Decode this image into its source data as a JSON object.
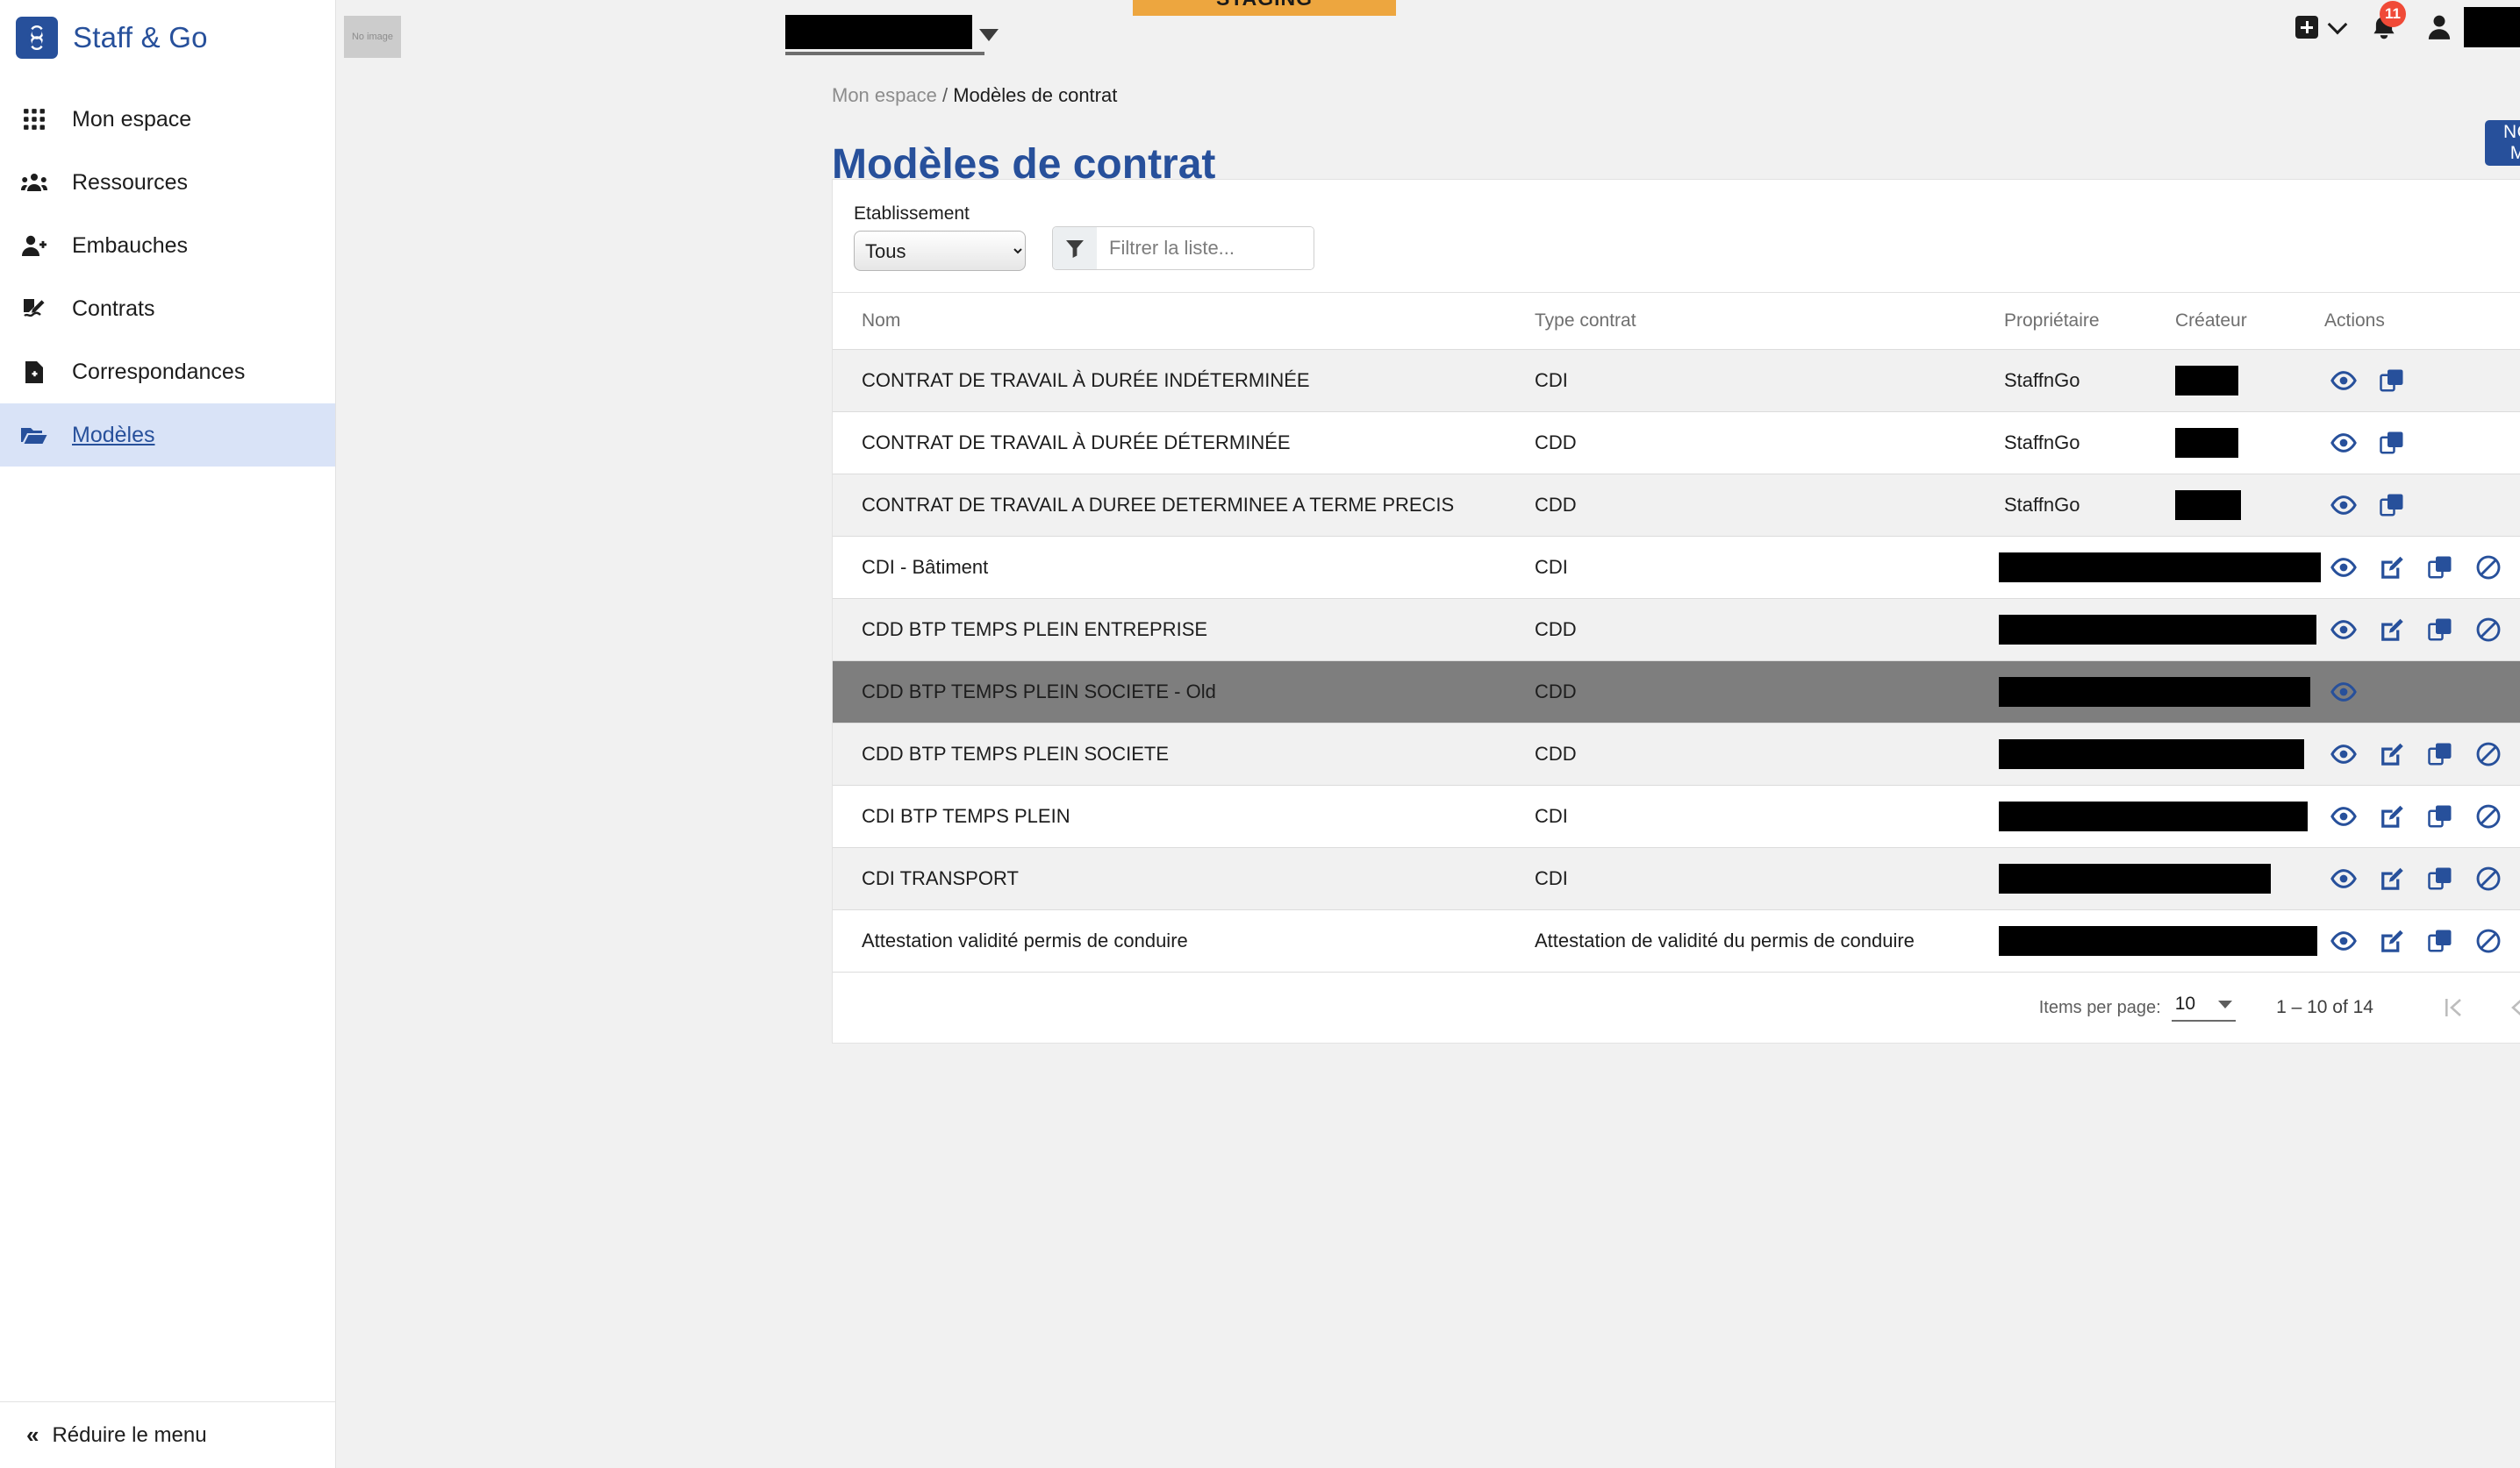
{
  "brand": {
    "name": "Staff & Go",
    "logo_icon": "infinity-s-logo"
  },
  "sidebar": {
    "items": [
      {
        "label": "Mon espace",
        "icon": "grid-icon",
        "active": false
      },
      {
        "label": "Ressources",
        "icon": "people-group-icon",
        "active": false
      },
      {
        "label": "Embauches",
        "icon": "person-add-icon",
        "active": false
      },
      {
        "label": "Contrats",
        "icon": "contract-sign-icon",
        "active": false
      },
      {
        "label": "Correspondances",
        "icon": "document-plus-icon",
        "active": false
      },
      {
        "label": "Modèles",
        "icon": "folder-open-icon",
        "active": true
      }
    ],
    "collapse_label": "Réduire le menu",
    "collapse_icon": "double-chevron-left-icon"
  },
  "topbar": {
    "staging_label": "STAGING",
    "staging_color": "#eda63f",
    "no_image_label": "No image",
    "establishment_value": "",
    "add_icon": "plus-box-icon",
    "add_chevron_icon": "chevron-down-icon",
    "bell_icon": "bell-icon",
    "notification_count": "11",
    "notification_color": "#f04a37",
    "user_icon": "person-icon"
  },
  "breadcrumb": {
    "parent": "Mon espace",
    "separator": "/",
    "current": "Modèles de contrat"
  },
  "page": {
    "title": "Modèles de contrat",
    "title_color": "#27509b"
  },
  "new_button": {
    "label": "NOUVEAU MODÈLE",
    "color": "#27509b"
  },
  "filters": {
    "establishment_label": "Etablissement",
    "establishment_selected": "Tous",
    "establishment_options": [
      "Tous"
    ],
    "filter_icon": "funnel-icon",
    "filter_placeholder": "Filtrer la liste...",
    "filter_value": ""
  },
  "table": {
    "columns": [
      "Nom",
      "Type contrat",
      "Propriétaire",
      "Créateur",
      "Actions"
    ],
    "rows": [
      {
        "nom": "CONTRAT DE TRAVAIL À DURÉE INDÉTERMINÉE",
        "type": "CDI",
        "proprietaire": "StaffnGo",
        "createur": "",
        "createur_redacted_width": 72,
        "proprietaire_redacted_width": 0,
        "actions": [
          "eye-icon",
          "copy-icon"
        ],
        "style": "alt"
      },
      {
        "nom": "CONTRAT DE TRAVAIL À DURÉE DÉTERMINÉE",
        "type": "CDD",
        "proprietaire": "StaffnGo",
        "createur": "",
        "createur_redacted_width": 72,
        "proprietaire_redacted_width": 0,
        "actions": [
          "eye-icon",
          "copy-icon"
        ],
        "style": "plain"
      },
      {
        "nom": "CONTRAT DE TRAVAIL A DUREE DETERMINEE A TERME PRECIS",
        "type": "CDD",
        "proprietaire": "StaffnGo",
        "createur": "",
        "createur_redacted_width": 75,
        "proprietaire_redacted_width": 0,
        "actions": [
          "eye-icon",
          "copy-icon"
        ],
        "style": "alt"
      },
      {
        "nom": "CDI - Bâtiment",
        "type": "CDI",
        "proprietaire": "",
        "createur": "",
        "createur_redacted_width": 0,
        "proprietaire_redacted_width": 367,
        "actions": [
          "eye-icon",
          "edit-icon",
          "copy-icon",
          "ban-icon",
          "trash-icon"
        ],
        "style": "plain"
      },
      {
        "nom": "CDD BTP TEMPS PLEIN ENTREPRISE",
        "type": "CDD",
        "proprietaire": "",
        "createur": "",
        "createur_redacted_width": 0,
        "proprietaire_redacted_width": 362,
        "actions": [
          "eye-icon",
          "edit-icon",
          "copy-icon",
          "ban-icon",
          "trash-icon"
        ],
        "style": "alt"
      },
      {
        "nom": "CDD BTP TEMPS PLEIN SOCIETE - Old",
        "type": "CDD",
        "proprietaire": "",
        "createur": "",
        "createur_redacted_width": 0,
        "proprietaire_redacted_width": 355,
        "actions": [
          "eye-icon"
        ],
        "style": "hl"
      },
      {
        "nom": "CDD BTP TEMPS PLEIN SOCIETE",
        "type": "CDD",
        "proprietaire": "",
        "createur": "",
        "createur_redacted_width": 0,
        "proprietaire_redacted_width": 348,
        "actions": [
          "eye-icon",
          "edit-icon",
          "copy-icon",
          "ban-icon",
          "trash-icon"
        ],
        "style": "alt"
      },
      {
        "nom": "CDI BTP TEMPS PLEIN",
        "type": "CDI",
        "proprietaire": "",
        "createur": "",
        "createur_redacted_width": 0,
        "proprietaire_redacted_width": 352,
        "actions": [
          "eye-icon",
          "edit-icon",
          "copy-icon",
          "ban-icon",
          "trash-icon"
        ],
        "style": "plain"
      },
      {
        "nom": "CDI TRANSPORT",
        "type": "CDI",
        "proprietaire": "",
        "createur": "",
        "createur_redacted_width": 0,
        "proprietaire_redacted_width": 310,
        "actions": [
          "eye-icon",
          "edit-icon",
          "copy-icon",
          "ban-icon",
          "trash-icon"
        ],
        "style": "alt"
      },
      {
        "nom": "Attestation validité permis de conduire",
        "type": "Attestation de validité du permis de conduire",
        "proprietaire": "",
        "createur": "",
        "createur_redacted_width": 0,
        "proprietaire_redacted_width": 363,
        "actions": [
          "eye-icon",
          "edit-icon",
          "copy-icon",
          "ban-icon",
          "trash-icon"
        ],
        "style": "plain"
      }
    ]
  },
  "paginator": {
    "items_per_page_label": "Items per page:",
    "items_per_page_value": "10",
    "range_label": "1 – 10 of 14",
    "first_icon": "first-page-icon",
    "prev_icon": "previous-page-icon",
    "next_icon": "next-page-icon",
    "last_icon": "last-page-icon"
  },
  "colors": {
    "accent_blue": "#27509b",
    "danger_red": "#e8432a",
    "row_alt": "#f1f1f1",
    "row_highlight": "#7e7e7e"
  }
}
